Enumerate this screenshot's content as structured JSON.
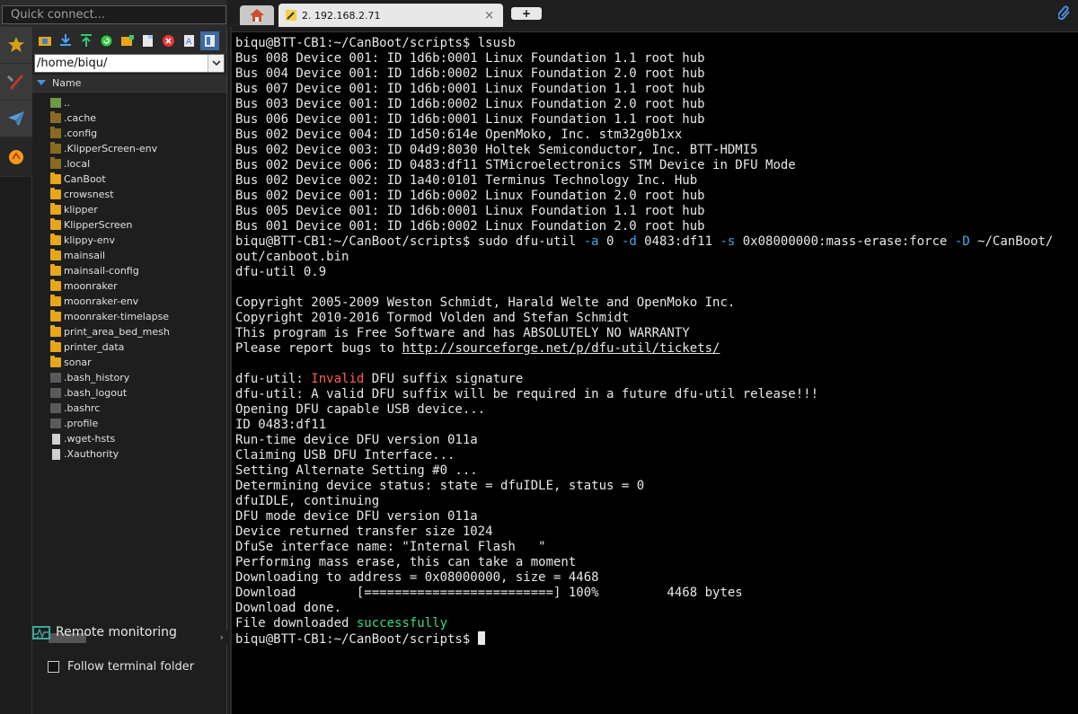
{
  "quick_connect": {
    "placeholder": "Quick connect..."
  },
  "file_panel": {
    "path": "/home/biqu/",
    "column_header": "Name",
    "files": [
      {
        "name": "..",
        "kind": "up"
      },
      {
        "name": ".cache",
        "kind": "hidden-folder"
      },
      {
        "name": ".config",
        "kind": "hidden-folder"
      },
      {
        "name": ".KlipperScreen-env",
        "kind": "hidden-folder"
      },
      {
        "name": ".local",
        "kind": "hidden-folder"
      },
      {
        "name": "CanBoot",
        "kind": "folder"
      },
      {
        "name": "crowsnest",
        "kind": "folder"
      },
      {
        "name": "klipper",
        "kind": "folder"
      },
      {
        "name": "KlipperScreen",
        "kind": "folder"
      },
      {
        "name": "klippy-env",
        "kind": "folder"
      },
      {
        "name": "mainsail",
        "kind": "folder"
      },
      {
        "name": "mainsail-config",
        "kind": "folder"
      },
      {
        "name": "moonraker",
        "kind": "folder"
      },
      {
        "name": "moonraker-env",
        "kind": "folder"
      },
      {
        "name": "moonraker-timelapse",
        "kind": "folder"
      },
      {
        "name": "print_area_bed_mesh",
        "kind": "folder"
      },
      {
        "name": "printer_data",
        "kind": "folder"
      },
      {
        "name": "sonar",
        "kind": "folder"
      },
      {
        "name": ".bash_history",
        "kind": "hidden-file"
      },
      {
        "name": ".bash_logout",
        "kind": "hidden-file"
      },
      {
        "name": ".bashrc",
        "kind": "hidden-file"
      },
      {
        "name": ".profile",
        "kind": "hidden-file"
      },
      {
        "name": ".wget-hsts",
        "kind": "file"
      },
      {
        "name": ".Xauthority",
        "kind": "file"
      }
    ],
    "remote_monitoring": "Remote monitoring",
    "follow_terminal_folder": "Follow terminal folder"
  },
  "tabs": {
    "active_label": "2. 192.168.2.71",
    "close": "×",
    "new_tab": "+"
  },
  "terminal": {
    "prompt": "biqu@BTT-CB1:~/CanBoot/scripts$",
    "lines": [
      [
        {
          "t": "biqu@BTT-CB1:~/CanBoot/scripts$ lsusb"
        }
      ],
      [
        {
          "t": "Bus 008 Device 001: ID 1d6b:0001 Linux Foundation 1.1 root hub"
        }
      ],
      [
        {
          "t": "Bus 004 Device 001: ID 1d6b:0002 Linux Foundation 2.0 root hub"
        }
      ],
      [
        {
          "t": "Bus 007 Device 001: ID 1d6b:0001 Linux Foundation 1.1 root hub"
        }
      ],
      [
        {
          "t": "Bus 003 Device 001: ID 1d6b:0002 Linux Foundation 2.0 root hub"
        }
      ],
      [
        {
          "t": "Bus 006 Device 001: ID 1d6b:0001 Linux Foundation 1.1 root hub"
        }
      ],
      [
        {
          "t": "Bus 002 Device 004: ID 1d50:614e OpenMoko, Inc. stm32g0b1xx"
        }
      ],
      [
        {
          "t": "Bus 002 Device 003: ID 04d9:8030 Holtek Semiconductor, Inc. BTT-HDMI5"
        }
      ],
      [
        {
          "t": "Bus 002 Device 006: ID 0483:df11 STMicroelectronics STM Device in DFU Mode"
        }
      ],
      [
        {
          "t": "Bus 002 Device 002: ID 1a40:0101 Terminus Technology Inc. Hub"
        }
      ],
      [
        {
          "t": "Bus 002 Device 001: ID 1d6b:0002 Linux Foundation 2.0 root hub"
        }
      ],
      [
        {
          "t": "Bus 005 Device 001: ID 1d6b:0001 Linux Foundation 1.1 root hub"
        }
      ],
      [
        {
          "t": "Bus 001 Device 001: ID 1d6b:0002 Linux Foundation 2.0 root hub"
        }
      ],
      [
        {
          "t": "biqu@BTT-CB1:~/CanBoot/scripts$ sudo dfu-util "
        },
        {
          "t": "-a",
          "c": "blue"
        },
        {
          "t": " 0 "
        },
        {
          "t": "-d",
          "c": "blue"
        },
        {
          "t": " 0483:df11 "
        },
        {
          "t": "-s",
          "c": "blue"
        },
        {
          "t": " 0x08000000:mass-erase:force "
        },
        {
          "t": "-D",
          "c": "blue"
        },
        {
          "t": " ~/CanBoot/"
        }
      ],
      [
        {
          "t": "out/canboot.bin"
        }
      ],
      [
        {
          "t": "dfu-util 0.9"
        }
      ],
      [
        {
          "t": ""
        }
      ],
      [
        {
          "t": "Copyright 2005-2009 Weston Schmidt, Harald Welte and OpenMoko Inc."
        }
      ],
      [
        {
          "t": "Copyright 2010-2016 Tormod Volden and Stefan Schmidt"
        }
      ],
      [
        {
          "t": "This program is Free Software and has ABSOLUTELY NO WARRANTY"
        }
      ],
      [
        {
          "t": "Please report bugs to "
        },
        {
          "t": "http://sourceforge.net/p/dfu-util/tickets/",
          "c": "ul"
        }
      ],
      [
        {
          "t": ""
        }
      ],
      [
        {
          "t": "dfu-util: "
        },
        {
          "t": "Invalid",
          "c": "red"
        },
        {
          "t": " DFU suffix signature"
        }
      ],
      [
        {
          "t": "dfu-util: A valid DFU suffix will be required in a future dfu-util release!!!"
        }
      ],
      [
        {
          "t": "Opening DFU capable USB device..."
        }
      ],
      [
        {
          "t": "ID 0483:df11"
        }
      ],
      [
        {
          "t": "Run-time device DFU version 011a"
        }
      ],
      [
        {
          "t": "Claiming USB DFU Interface..."
        }
      ],
      [
        {
          "t": "Setting Alternate Setting #0 ..."
        }
      ],
      [
        {
          "t": "Determining device status: state = dfuIDLE, status = 0"
        }
      ],
      [
        {
          "t": "dfuIDLE, continuing"
        }
      ],
      [
        {
          "t": "DFU mode device DFU version 011a"
        }
      ],
      [
        {
          "t": "Device returned transfer size 1024"
        }
      ],
      [
        {
          "t": "DfuSe interface name: \"Internal Flash   \""
        }
      ],
      [
        {
          "t": "Performing mass erase, this can take a moment"
        }
      ],
      [
        {
          "t": "Downloading to address = 0x08000000, size = 4468"
        }
      ],
      [
        {
          "t": "Download        [=========================] 100%         4468 bytes"
        }
      ],
      [
        {
          "t": "Download done."
        }
      ],
      [
        {
          "t": "File downloaded "
        },
        {
          "t": "successfully",
          "c": "green"
        }
      ],
      [
        {
          "t": "biqu@BTT-CB1:~/CanBoot/scripts$ "
        },
        {
          "t": "",
          "c": "cursor"
        }
      ]
    ]
  }
}
